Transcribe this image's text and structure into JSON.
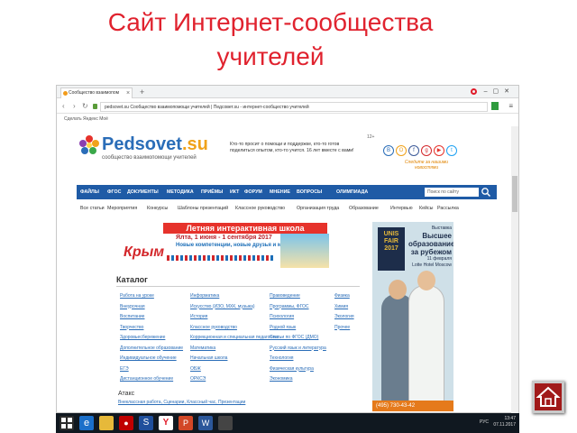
{
  "slide": {
    "title_line1": "Сайт Интернет-сообщества",
    "title_line2": "учителей"
  },
  "browser": {
    "tab_title": "Сообщество взаимопом",
    "address": "pedsovet.su  Сообщество взаимопомощи учителей  |  Педсовет.su - интернет-сообщество учителей",
    "bookmarks_text": "Сделать Яндекс Moё"
  },
  "site": {
    "logo_name": "Pedsovet",
    "logo_tld": ".su",
    "logo_sub": "сообщество взаимопомощи учителей",
    "promo_text": "Кто-то просит о помощи и поддержке, кто-то готов поделиться опытом, кто-то учится. 16 лет вместе с вами!",
    "age_mark": "12+",
    "social_caption": "Следите за нашими новостями",
    "nav": [
      "ФАЙЛЫ",
      "ФГОС",
      "ДОКУМЕНТЫ",
      "МЕТОДИКА",
      "ПРИЁМЫ",
      "ИКТ",
      "ФОРУМ",
      "МНЕНИЕ",
      "ВОПРОСЫ",
      "ОЛИМПИАДА"
    ],
    "search_placeholder": "Поиск по сайту",
    "subnav": [
      "Все статьи",
      "Мероприятия",
      "Конкурсы",
      "Шаблоны презентаций",
      "Классное руководство",
      "Организация труда",
      "Образование",
      "Интервью",
      "Кейсы",
      "Рассылка"
    ],
    "banner": {
      "head": "Летняя интерактивная школа",
      "dates": "Ялта, 1 июня - 1 сентября 2017",
      "tagline": "Новые компетенции, новые друзья и море отдыха!",
      "region": "Крым"
    },
    "catalog": {
      "title": "Каталог",
      "columns": [
        [
          "Работа на уроке",
          "Внеурочная",
          "Воспитание",
          "Творчество",
          "Здоровьесбережение",
          "Дополнительное образование",
          "Индивидуальное обучение",
          "ЕГЭ",
          "Дистанционное обучение"
        ],
        [
          "Информатика",
          "Искусство (ИЗО, МХК, музыка)",
          "История",
          "Классное руководство",
          "Коррекционная и специальная педагогика",
          "Математика",
          "Начальная школа",
          "ОБЖ",
          "ОРКСЭ"
        ],
        [
          "Правоведение",
          "Программы, ФГОС",
          "Психология",
          "Родной язык",
          "Статьи по ФГОС (ДМО)",
          "Русский язык и литература",
          "Технология",
          "Физическая культура",
          "Экономика"
        ],
        [
          "Физика",
          "Химия",
          "Экология",
          "Прочее"
        ]
      ]
    },
    "tags": {
      "title": "Атакс",
      "links": "Внеклассная работа, Сценарии, Классный час, Презентации"
    },
    "ad": {
      "brand": "UNIS FAIR 2017",
      "line1": "Выставка",
      "line2": "Высшее образование за рубежом",
      "line3": "11 февраля",
      "line4": "Lotte Hotel Moscow",
      "phone": "(495) 730-43-42"
    }
  },
  "taskbar": {
    "lang": "РУС",
    "time": "13:47",
    "date": "07.11.2017"
  },
  "colors": {
    "title_red": "#e0222e",
    "nav_blue": "#1f5ba6",
    "link_blue": "#2a6db8",
    "home_red": "#a11a1a"
  }
}
